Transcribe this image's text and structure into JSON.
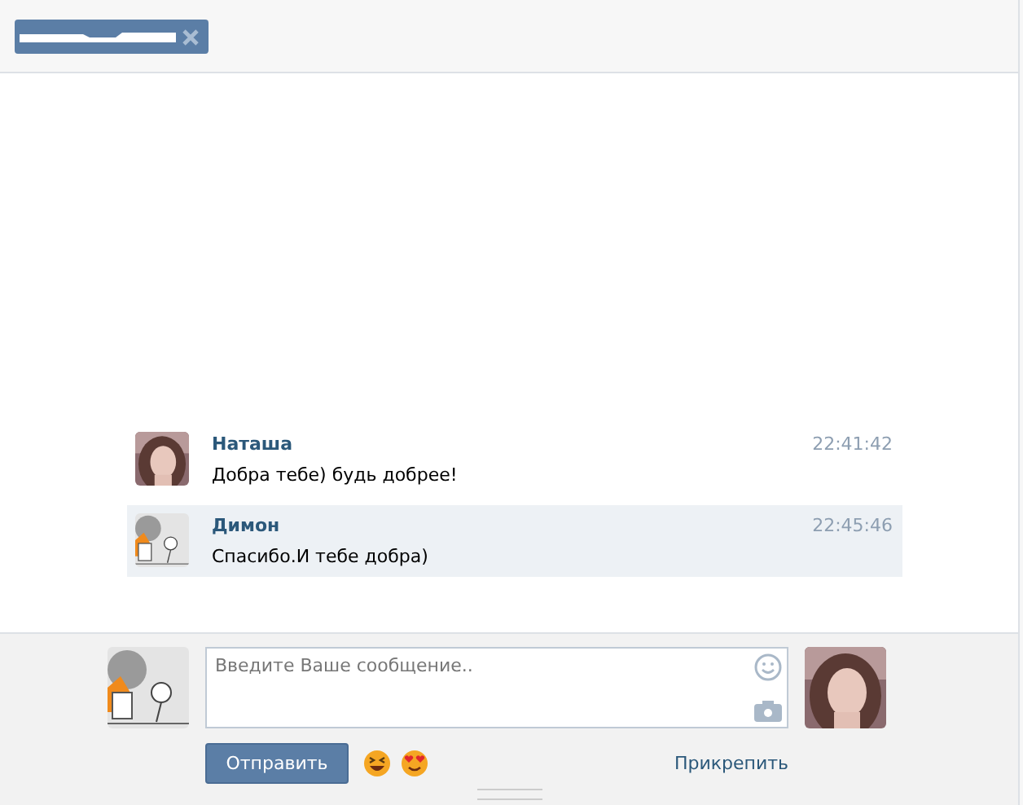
{
  "messages": [
    {
      "author": "Наташа",
      "text": "Добра тебе) будь добрее!",
      "time": "22:41:42",
      "highlighted": false
    },
    {
      "author": "Димон",
      "text": "Спасибо.И тебе добра)",
      "time": "22:45:46",
      "highlighted": true
    }
  ],
  "composer": {
    "placeholder": "Введите Ваше сообщение..",
    "send": "Отправить",
    "attach": "Прикрепить"
  }
}
